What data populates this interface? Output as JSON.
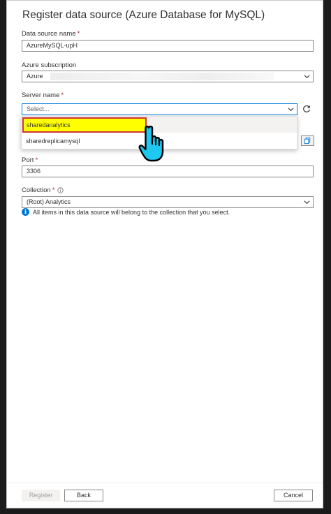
{
  "panel": {
    "title": "Register data source (Azure Database for MySQL)"
  },
  "fields": {
    "data_source_name": {
      "label": "Data source name",
      "value": "AzureMySQL-upH"
    },
    "azure_subscription": {
      "label": "Azure subscription",
      "value": "Azure"
    },
    "server_name": {
      "label": "Server name",
      "placeholder": "Select...",
      "options": [
        "sharedanalytics",
        "sharedreplicamysql"
      ]
    },
    "port": {
      "label": "Port",
      "value": "3306"
    },
    "collection": {
      "label": "Collection",
      "value": "(Root) Analytics",
      "info_text": "All items in this data source will belong to the collection that you select."
    }
  },
  "required_marker": "*",
  "icons": {
    "chevron": "chevron-down-icon",
    "refresh": "refresh-icon",
    "copy": "copy-icon",
    "info": "info-icon",
    "tooltip": "info-circle-icon",
    "cursor": "hand-pointer-icon"
  },
  "footer": {
    "register_label": "Register",
    "back_label": "Back",
    "cancel_label": "Cancel"
  },
  "colors": {
    "accent": "#0078d4",
    "highlight": "#ffff00",
    "highlight_border": "#d13438",
    "required": "#a4262c"
  }
}
